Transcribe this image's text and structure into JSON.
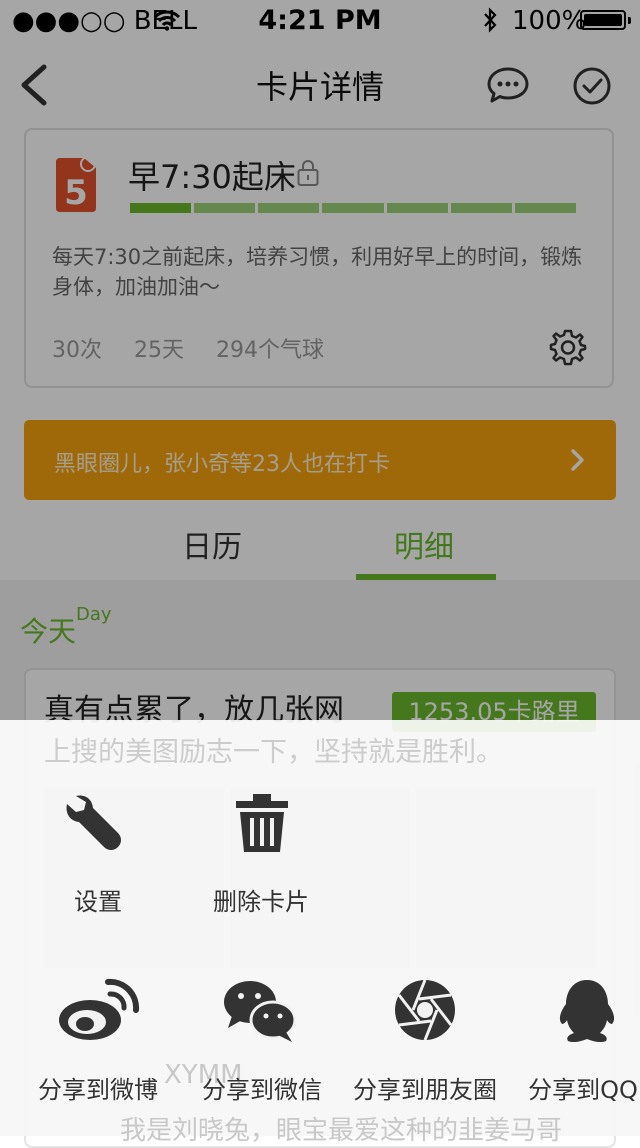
{
  "status_bar": {
    "carrier": "●●●○○ BELL",
    "time": "4:21 PM",
    "battery": "100%"
  },
  "nav": {
    "title": "卡片详情"
  },
  "card": {
    "title": "早7:30起床",
    "progress_segments": 7,
    "progress_filled": 1,
    "description": "每天7:30之前起床，培养习惯，利用好早上的时间，锻炼身体，加油加油～",
    "stats": [
      "30次",
      "25天",
      "294个气球"
    ]
  },
  "banner": {
    "text": "黑眼圈儿，张小奇等23人也在打卡"
  },
  "tabs": [
    {
      "label": "日历"
    },
    {
      "label": "明细"
    }
  ],
  "today": {
    "label": "今天",
    "sup": "Day"
  },
  "entry": {
    "text": "真有点累了，放几张网",
    "calories": "1253.05卡路里",
    "text2": "上搜的美图励志一下，坚持就是胜利。"
  },
  "background_fragments": {
    "line1": "XYMM",
    "line2": "我是刘晓兔，眼宝最爱这种的韭姜马哥"
  },
  "colors": {
    "accent": "#6ab82d",
    "banner": "#f4a20e",
    "icon": "#333333"
  },
  "sheet": {
    "actions": [
      {
        "label": "设置",
        "icon": "wrench-icon"
      },
      {
        "label": "删除卡片",
        "icon": "trash-icon"
      }
    ],
    "shares": [
      {
        "label": "分享到微博",
        "icon": "weibo-icon"
      },
      {
        "label": "分享到微信",
        "icon": "wechat-icon"
      },
      {
        "label": "分享到朋友圈",
        "icon": "moments-icon"
      },
      {
        "label": "分享到QQ",
        "icon": "qq-icon"
      }
    ]
  }
}
